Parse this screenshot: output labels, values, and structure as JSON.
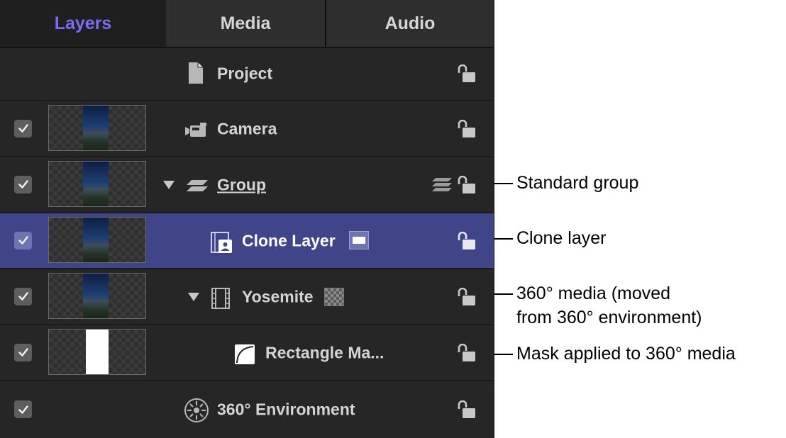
{
  "tabs": [
    {
      "label": "Layers",
      "active": true
    },
    {
      "label": "Media",
      "active": false
    },
    {
      "label": "Audio",
      "active": false
    }
  ],
  "rows": [
    {
      "label": "Project",
      "icon": "document-icon",
      "checked": null,
      "lock": "unlocked-icon"
    },
    {
      "label": "Camera",
      "icon": "camera-icon",
      "checked": true,
      "lock": "unlocked-icon"
    },
    {
      "label": "Group",
      "icon": "group-layers-icon",
      "checked": true,
      "disclosure": "expanded",
      "badge": "stack-icon",
      "lock": "unlocked-icon"
    },
    {
      "label": "Clone Layer",
      "icon": "clone-layer-icon",
      "checked": true,
      "selected": true,
      "badge": "white-rectangle-swatch",
      "lock": "unlocked-icon"
    },
    {
      "label": "Yosemite",
      "icon": "film-strip-icon",
      "checked": true,
      "disclosure": "expanded",
      "badge": "checkerboard-swatch",
      "lock": "unlocked-icon"
    },
    {
      "label": "Rectangle Ma...",
      "icon": "mask-shape-icon",
      "checked": true,
      "lock": "unlocked-icon"
    },
    {
      "label": "360° Environment",
      "icon": "360-environment-icon",
      "checked": true,
      "lock": "unlocked-icon"
    }
  ],
  "callouts": [
    {
      "text": "Standard group"
    },
    {
      "text": "Clone layer"
    },
    {
      "line1": "360° media (moved",
      "line2": "from 360° environment)"
    },
    {
      "text": "Mask applied to 360° media"
    }
  ],
  "colors": {
    "panel_bg": "#262626",
    "active_tab_text": "#7b6cf6",
    "selected_row": "#3f4588",
    "text": "#d4d4d4"
  }
}
